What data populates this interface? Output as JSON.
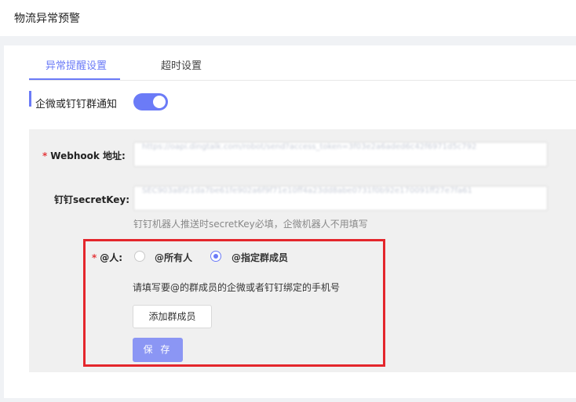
{
  "header": {
    "title": "物流异常预警"
  },
  "tabs": [
    {
      "label": "异常提醒设置",
      "active": true
    },
    {
      "label": "超时设置",
      "active": false
    }
  ],
  "section": {
    "title": "企微或钉钉群通知",
    "switch_on": true
  },
  "form": {
    "webhook": {
      "required_mark": "*",
      "label": "Webhook 地址:",
      "value": "https://oapi.dingtalk.com/robot/send?access_token=3f03e2a6aded6c42f6971d5c792"
    },
    "secret": {
      "label": "钉钉secretKey:",
      "value": "SEC903a8f21da7be61fe902a6f9f71e10ff4a23dd8abe0731f0b92e170091ff27e7fa61",
      "hint": "钉钉机器人推送时secretKey必填，企微机器人不用填写"
    },
    "mention": {
      "required_mark": "*",
      "label": "@人:",
      "options": [
        {
          "label": "@所有人",
          "checked": false
        },
        {
          "label": "@指定群成员",
          "checked": true
        }
      ],
      "hint": "请填写要@的群成员的企微或者钉钉绑定的手机号",
      "add_button": "添加群成员"
    },
    "save_button": "保 存"
  },
  "colors": {
    "accent": "#6b7bf7",
    "primary_button": "#8b96f4",
    "highlight_box": "#e4262c",
    "required": "#e4393c"
  }
}
